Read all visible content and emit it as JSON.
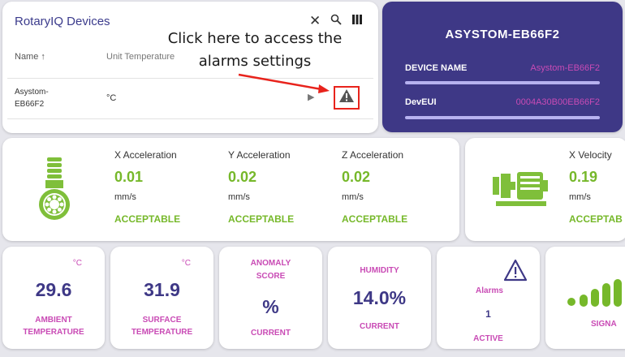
{
  "devices": {
    "title": "RotaryIQ Devices",
    "tools": {
      "close": "✕",
      "search": "⚲",
      "columns": "▥"
    },
    "columns": {
      "name": "Name ↑",
      "unit_temperature": "Unit Temperature"
    },
    "row": {
      "name": "Asystom-EB66F2",
      "unit": "°C",
      "play": "▶"
    },
    "annotation": "Click here to access the alarms settings"
  },
  "device_card": {
    "title": "ASYSTOM-EB66F2",
    "device_name_label": "DEVICE NAME",
    "device_name_value": "Asystom-EB66F2",
    "deveui_label": "DevEUI",
    "deveui_value": "0004A30B00EB66F2"
  },
  "accelerations": [
    {
      "label": "X Acceleration",
      "value": "0.01",
      "unit": "mm/s",
      "status": "ACCEPTABLE"
    },
    {
      "label": "Y Acceleration",
      "value": "0.02",
      "unit": "mm/s",
      "status": "ACCEPTABLE"
    },
    {
      "label": "Z Acceleration",
      "value": "0.02",
      "unit": "mm/s",
      "status": "ACCEPTABLE"
    }
  ],
  "velocity": {
    "label": "X Velocity",
    "value": "0.19",
    "unit": "mm/s",
    "status": "ACCEPTAB"
  },
  "tiles": {
    "ambient": {
      "unit": "°C",
      "value": "29.6",
      "caption_line1": "AMBIENT",
      "caption_line2": "TEMPERATURE"
    },
    "surface": {
      "unit": "°C",
      "value": "31.9",
      "caption_line1": "SURFACE",
      "caption_line2": "TEMPERATURE"
    },
    "anomaly": {
      "title_line1": "ANOMALY",
      "title_line2": "SCORE",
      "value": "%",
      "caption": "CURRENT"
    },
    "humidity": {
      "title": "HUMIDITY",
      "value": "14.0%",
      "caption": "CURRENT"
    },
    "alarms": {
      "label": "Alarms",
      "count": "1",
      "caption": "ACTIVE"
    },
    "signal": {
      "caption": "SIGNA"
    }
  },
  "colors": {
    "brand_purple": "#3e3886",
    "accent_pink": "#c94bb5",
    "status_green": "#76b82a",
    "highlight_red": "#e8231c"
  }
}
